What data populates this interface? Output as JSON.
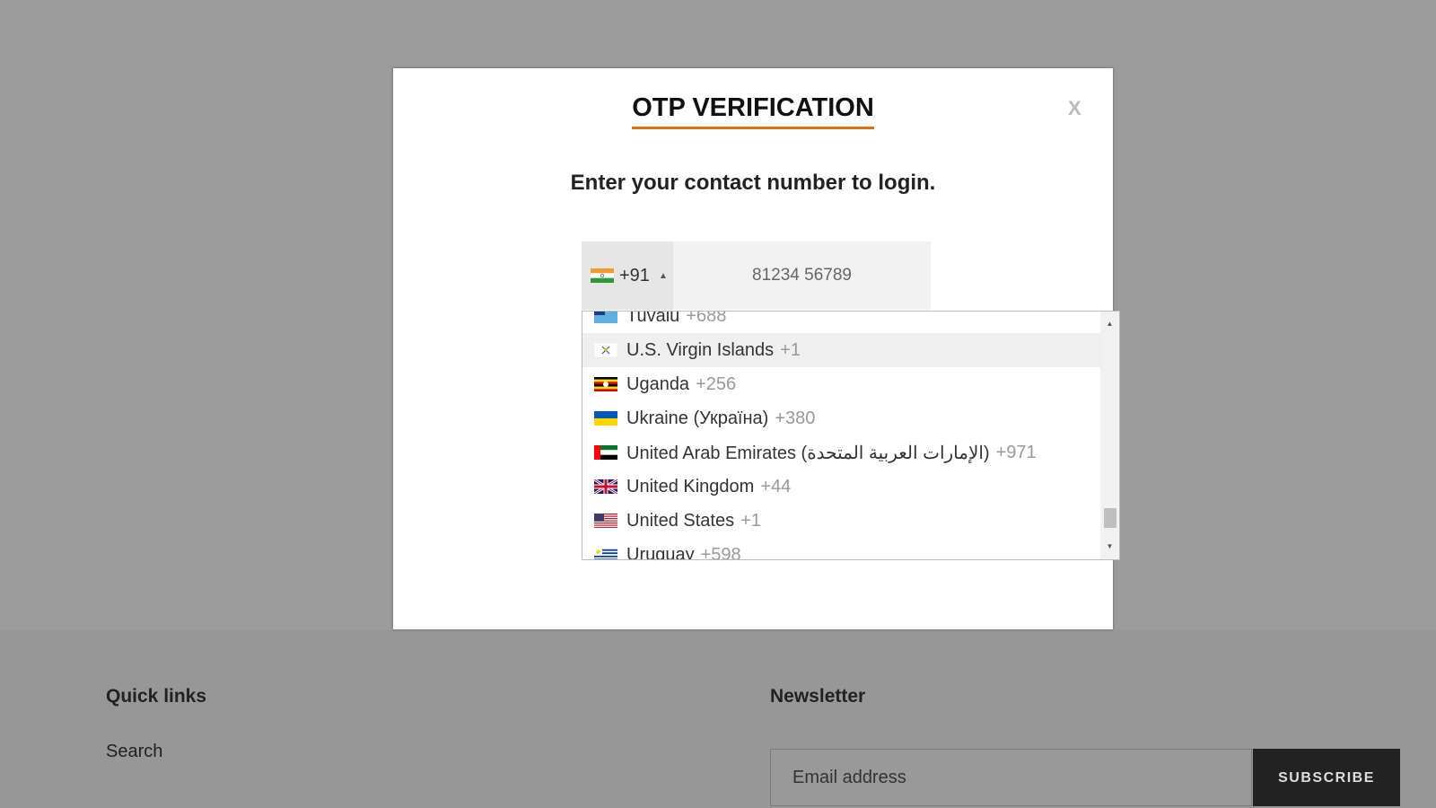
{
  "modal": {
    "title": "OTP VERIFICATION",
    "close_label": "X",
    "subtitle": "Enter your contact number to login.",
    "dial_code": "+91",
    "phone_placeholder": "81234 56789"
  },
  "dropdown": {
    "items": [
      {
        "name": "Tuvalu",
        "code": "+688",
        "flag_icon": "tuvalu-flag-icon"
      },
      {
        "name": "U.S. Virgin Islands",
        "code": "+1",
        "flag_icon": "us-virgin-islands-flag-icon"
      },
      {
        "name": "Uganda",
        "code": "+256",
        "flag_icon": "uganda-flag-icon"
      },
      {
        "name": "Ukraine (Україна)",
        "code": "+380",
        "flag_icon": "ukraine-flag-icon"
      },
      {
        "name": "United Arab Emirates (‫الإمارات العربية المتحدة‬‎)",
        "code": "+971",
        "flag_icon": "uae-flag-icon"
      },
      {
        "name": "United Kingdom",
        "code": "+44",
        "flag_icon": "uk-flag-icon"
      },
      {
        "name": "United States",
        "code": "+1",
        "flag_icon": "us-flag-icon"
      },
      {
        "name": "Uruguay",
        "code": "+598",
        "flag_icon": "uruguay-flag-icon"
      }
    ]
  },
  "footer": {
    "quick_links_title": "Quick links",
    "search_link": "Search",
    "newsletter_title": "Newsletter",
    "email_placeholder": "Email address",
    "subscribe_label": "SUBSCRIBE"
  },
  "colors": {
    "accent_underline": "#e07010",
    "overlay": "#9b9b9b",
    "button_dark": "#222222"
  }
}
